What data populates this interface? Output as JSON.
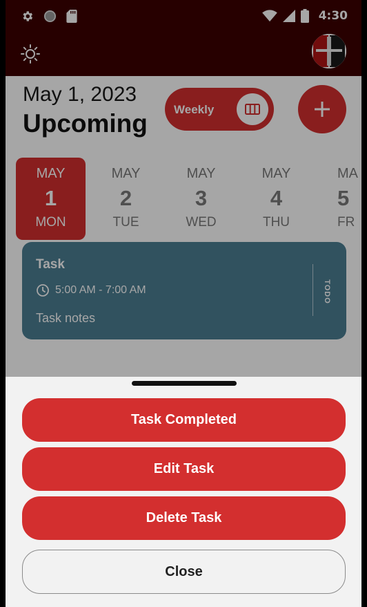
{
  "status_bar": {
    "time": "4:30",
    "icons": [
      "settings-icon",
      "circle-icon",
      "sd-card-icon",
      "wifi-icon",
      "signal-icon",
      "battery-icon"
    ]
  },
  "app_bar": {
    "icons": [
      "theme-brightness-icon",
      "avatar-logo"
    ]
  },
  "header": {
    "date": "May 1, 2023",
    "title": "Upcoming"
  },
  "view_toggle": {
    "label": "Weekly",
    "icon": "view-columns-icon"
  },
  "add_button": {
    "icon": "plus-icon"
  },
  "days": [
    {
      "month": "MAY",
      "num": "1",
      "dow": "MON",
      "selected": true
    },
    {
      "month": "MAY",
      "num": "2",
      "dow": "TUE",
      "selected": false
    },
    {
      "month": "MAY",
      "num": "3",
      "dow": "WED",
      "selected": false
    },
    {
      "month": "MAY",
      "num": "4",
      "dow": "THU",
      "selected": false
    },
    {
      "month": "MA",
      "num": "5",
      "dow": "FR",
      "selected": false
    }
  ],
  "task": {
    "title": "Task",
    "time": "5:00 AM - 7:00 AM",
    "notes": "Task notes",
    "status": "TODO",
    "color": "#4c7e93"
  },
  "bottom_sheet": {
    "task_completed": "Task Completed",
    "edit_task": "Edit Task",
    "delete_task": "Delete Task",
    "close": "Close"
  },
  "colors": {
    "accent": "#d32f2f",
    "app_bar": "#3d0000",
    "sheet_bg": "#f2f2f2"
  }
}
